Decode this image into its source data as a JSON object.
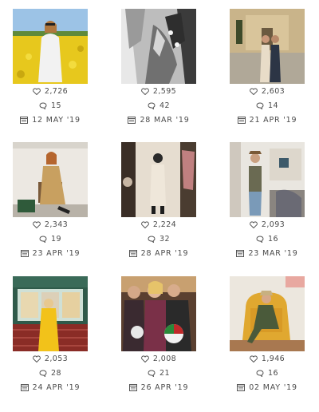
{
  "posts": [
    {
      "likes": "2,726",
      "comments": "15",
      "date": "12 MAY '19",
      "image": "woman in white sweater in yellow rapeseed field"
    },
    {
      "likes": "2,595",
      "comments": "42",
      "date": "28 MAR '19",
      "image": "black and white close-up of woman with patterned jacket"
    },
    {
      "likes": "2,603",
      "comments": "14",
      "date": "21 APR '19",
      "image": "couple in front of baroque church facade"
    },
    {
      "likes": "2,343",
      "comments": "19",
      "date": "23 APR '19",
      "image": "woman in mustard dress seated on chair, green bag"
    },
    {
      "likes": "2,224",
      "comments": "32",
      "date": "28 APR '19",
      "image": "mirror selfie in closet with patterned outfit"
    },
    {
      "likes": "2,093",
      "comments": "16",
      "date": "23 MAR '19",
      "image": "mirror selfie in apartment wearing hat and denim"
    },
    {
      "likes": "2,053",
      "comments": "28",
      "date": "24 APR '19",
      "image": "woman in yellow coat at bakery storefront"
    },
    {
      "likes": "2,008",
      "comments": "21",
      "date": "26 APR '19",
      "image": "group of friends smiling with red-green bag"
    },
    {
      "likes": "1,946",
      "comments": "16",
      "date": "02 MAY '19",
      "image": "woman lounging on mustard armchair"
    }
  ],
  "colors": {
    "text": "#4a4a4a",
    "icon": "#555555"
  }
}
